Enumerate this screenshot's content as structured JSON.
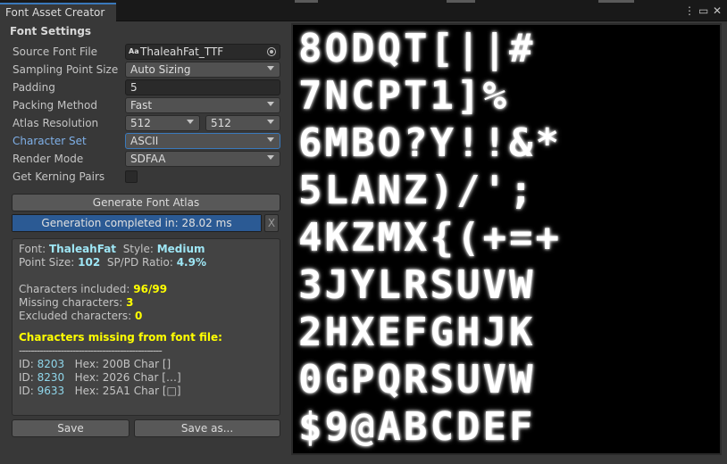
{
  "window": {
    "tab_title": "Font Asset Creator",
    "menu_icon": "kebab-menu-icon",
    "maximize_icon": "maximize-icon",
    "close_icon": "close-icon"
  },
  "settings": {
    "section_title": "Font Settings",
    "source_font_label": "Source Font File",
    "source_font_value": "ThaleahFat_TTF",
    "sampling_label": "Sampling Point Size",
    "sampling_value": "Auto Sizing",
    "padding_label": "Padding",
    "padding_value": "5",
    "packing_label": "Packing Method",
    "packing_value": "Fast",
    "atlas_label": "Atlas Resolution",
    "atlas_width": "512",
    "atlas_height": "512",
    "charset_label": "Character Set",
    "charset_value": "ASCII",
    "render_label": "Render Mode",
    "render_value": "SDFAA",
    "kerning_label": "Get Kerning Pairs"
  },
  "actions": {
    "generate_label": "Generate Font Atlas",
    "progress_text": "Generation completed in: 28.02 ms",
    "progress_value": 1.0,
    "cancel_label": "X",
    "save_label": "Save",
    "save_as_label": "Save as..."
  },
  "info": {
    "font_label": "Font:",
    "font_value": "ThaleahFat",
    "style_label": "Style:",
    "style_value": "Medium",
    "point_label": "Point Size:",
    "point_value": "102",
    "ratio_label": "SP/PD Ratio:",
    "ratio_value": "4.9%",
    "included_label": "Characters included:",
    "included_value": "96/99",
    "missing_label": "Missing characters:",
    "missing_value": "3",
    "excluded_label": "Excluded characters:",
    "excluded_value": "0",
    "missing_header": "Characters missing from font file:",
    "separator": "------------------------------------------------",
    "missing": [
      {
        "id": "8203",
        "hex": "200B",
        "char": "Char []"
      },
      {
        "id": "8230",
        "hex": "2026",
        "char": "Char […]"
      },
      {
        "id": "9633",
        "hex": "25A1",
        "char": "Char [□]"
      }
    ]
  },
  "atlas_rows": [
    [
      "8",
      "O",
      "D",
      "Q",
      "T",
      "[",
      "|",
      "|",
      "#"
    ],
    [
      "7",
      "N",
      "C",
      "P",
      "T",
      "1",
      "]",
      "%"
    ],
    [
      "6",
      "M",
      "B",
      "O",
      "?",
      "Y",
      "!",
      "!",
      "&",
      "*"
    ],
    [
      "5",
      "L",
      "A",
      "N",
      "Z",
      ")",
      "/",
      "'",
      ";"
    ],
    [
      "4",
      "K",
      "Z",
      "M",
      "X",
      "{",
      "(",
      "+",
      "=",
      "+"
    ],
    [
      "3",
      "J",
      "Y",
      "L",
      "R",
      "S",
      "U",
      "V",
      "W"
    ],
    [
      "2",
      "H",
      "X",
      "E",
      "F",
      "G",
      "H",
      "J",
      "K"
    ],
    [
      "0",
      "G",
      "P",
      "Q",
      "R",
      "S",
      "U",
      "V",
      "W"
    ],
    [
      "$",
      "9",
      "@",
      "A",
      "B",
      "C",
      "D",
      "E",
      "F"
    ]
  ]
}
